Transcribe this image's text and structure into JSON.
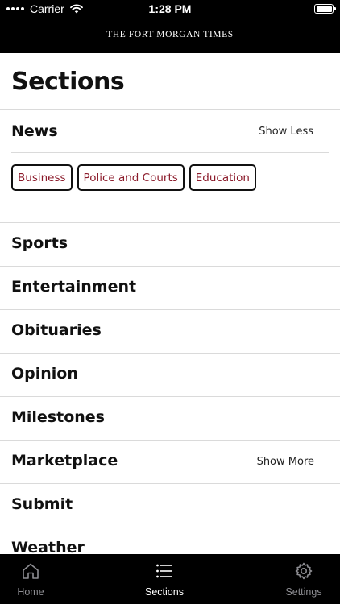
{
  "status_bar": {
    "carrier": "Carrier",
    "time": "1:28 PM",
    "wifi_icon": "wifi-icon",
    "battery_icon": "battery-icon"
  },
  "header": {
    "masthead": "THE FORT MORGAN TIMES"
  },
  "page": {
    "title": "Sections"
  },
  "news": {
    "label": "News",
    "action": "Show Less",
    "chips": [
      "Business",
      "Police and Courts",
      "Education"
    ]
  },
  "sections": [
    {
      "label": "Sports",
      "action": ""
    },
    {
      "label": "Entertainment",
      "action": ""
    },
    {
      "label": "Obituaries",
      "action": ""
    },
    {
      "label": "Opinion",
      "action": ""
    },
    {
      "label": "Milestones",
      "action": ""
    },
    {
      "label": "Marketplace",
      "action": "Show More"
    },
    {
      "label": "Submit",
      "action": ""
    },
    {
      "label": "Weather",
      "action": ""
    }
  ],
  "tabbar": {
    "tabs": [
      {
        "label": "Home",
        "icon": "home-icon",
        "active": false
      },
      {
        "label": "Sections",
        "icon": "list-icon",
        "active": true
      },
      {
        "label": "Settings",
        "icon": "gear-icon",
        "active": false
      }
    ]
  },
  "colors": {
    "chip_text": "#8b1a2a",
    "active_tab": "#ffffff",
    "inactive_tab": "#8e8e93",
    "header_bg": "#000000"
  }
}
